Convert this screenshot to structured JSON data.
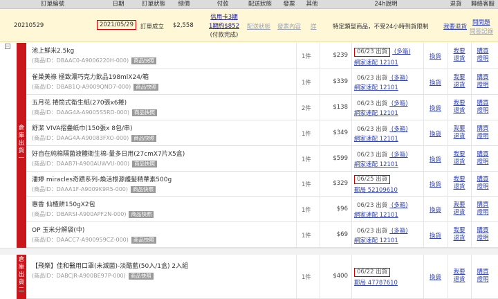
{
  "header": {
    "order_no": "訂單編號",
    "date": "日期",
    "order_status": "訂單狀態",
    "total": "總價",
    "payment": "付款",
    "shipping_status": "配送狀態",
    "invoice": "發票",
    "other": "其他",
    "note24h": "24h說明",
    "return": "退貨",
    "contact": "聯絡客服"
  },
  "summary": {
    "order_no": "20210529",
    "date": "2021/05/29",
    "status": "訂單成立",
    "total": "$2,558",
    "pay_line1": "信用卡3期",
    "pay_line2": "1期約$852",
    "pay_line3": "(付款完成)",
    "shipping_status": "配送狀態",
    "invoice": "發票內容",
    "other": "詳",
    "note": "特定類型商品，不受24小時到貨限制",
    "return": "我要退貨",
    "contact1": "問問題",
    "contact2": "問答記錄"
  },
  "warehouses": [
    {
      "label": "倉庫出貨一"
    },
    {
      "label": "倉庫出貨二"
    }
  ],
  "labels": {
    "exchange": "換貨",
    "return1": "我要",
    "return2": "退貨",
    "buy1": "購買",
    "buy2": "證明",
    "qty_suffix": "件",
    "product_tag": "商品快照"
  },
  "items": [
    {
      "name": "池上鮮米2.5kg",
      "code": "(商品ID：DBAAC0-A9006220H-000)",
      "qty": "1",
      "price": "$239",
      "ship_date": "06/23 出貨",
      "ship_more": "(多箱)",
      "carrier": "網家速配 12101",
      "boxed": true
    },
    {
      "name": "雀巢美祿 極致濃巧克力飲品198mlX24/箱",
      "code": "(商品ID：DBAB1Q-A9009QND7-000)",
      "qty": "1",
      "price": "$339",
      "ship_date": "06/23 出貨",
      "ship_more": "(多箱)",
      "carrier": "網家速配 12101",
      "boxed": false
    },
    {
      "name": "五月花 捲筒式衛生紙(270張x6捲)",
      "code": "(商品ID：DAAG4A-A9005S5RD-000)",
      "qty": "2",
      "price": "$138",
      "ship_date": "06/23 出貨",
      "ship_more": "(多箱)",
      "carrier": "網家速配 12101",
      "boxed": false
    },
    {
      "name": "舒潔 VIVA摺疊紙巾(150張x 8包/串)",
      "code": "(商品ID：DAAG4A-A90083FXO-000)",
      "qty": "1",
      "price": "$349",
      "ship_date": "06/23 出貨",
      "ship_more": "(多箱)",
      "carrier": "網家速配 12101",
      "boxed": false
    },
    {
      "name": "好自在純棉隔菌液體衛生棉-量多日用(27cmX7片X5盒)",
      "code": "(商品ID：DAAB7I-A900AUWVU-000)",
      "qty": "1",
      "price": "$599",
      "ship_date": "06/23 出貨",
      "ship_more": "(多箱)",
      "carrier": "網家速配 12101",
      "boxed": false
    },
    {
      "name": "潘婷 miracles奇蹟系列-煥活根源護髮精華素500g",
      "code": "(商品ID：DAAA1F-A9009K9R5-000)",
      "qty": "1",
      "price": "$329",
      "ship_date": "06/25 出貨",
      "ship_more": "",
      "carrier": "郵局 52109610",
      "boxed": true
    },
    {
      "name": "惠香 仙楂餅150gX2包",
      "code": "(商品ID：DBARSI-A900APF2N-000)",
      "qty": "1",
      "price": "$96",
      "ship_date": "06/23 出貨",
      "ship_more": "(多箱)",
      "carrier": "網家速配 12101",
      "boxed": false
    },
    {
      "name": "OP 玉米分解袋(中)",
      "code": "(商品ID：DAACC7-A900959CZ-000)",
      "qty": "1",
      "price": "$69",
      "ship_date": "06/23 出貨",
      "ship_more": "(多箱)",
      "carrier": "網家速配 12101",
      "boxed": false
    },
    {
      "name": "【飛樂】佳和醫用口罩(未滅菌)-淡酷藍(50入/1盒) 2入組",
      "code": "(商品ID：DABCJR-A900BE97P-000)",
      "qty": "1",
      "price": "$400",
      "ship_date": "06/22 出貨",
      "ship_more": "",
      "carrier": "郵局 47787610",
      "boxed": true
    }
  ]
}
